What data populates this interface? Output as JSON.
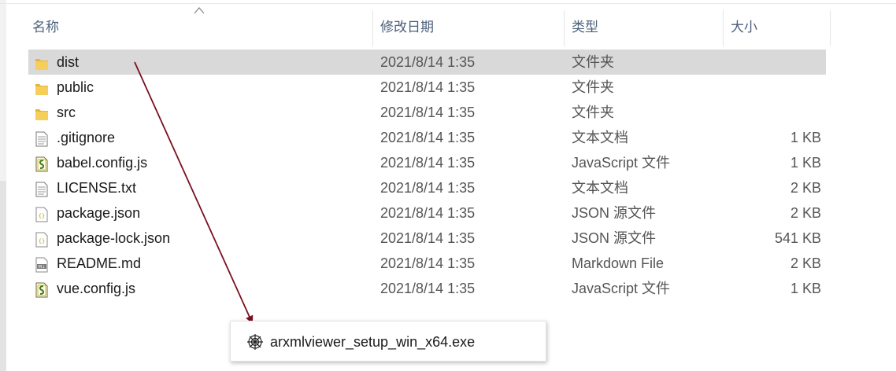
{
  "columns": {
    "name": "名称",
    "date": "修改日期",
    "type": "类型",
    "size": "大小"
  },
  "files": [
    {
      "name": "dist",
      "date": "2021/8/14 1:35",
      "type": "文件夹",
      "size": "",
      "icon": "folder-icon",
      "selected": true
    },
    {
      "name": "public",
      "date": "2021/8/14 1:35",
      "type": "文件夹",
      "size": "",
      "icon": "folder-icon"
    },
    {
      "name": "src",
      "date": "2021/8/14 1:35",
      "type": "文件夹",
      "size": "",
      "icon": "folder-icon"
    },
    {
      "name": ".gitignore",
      "date": "2021/8/14 1:35",
      "type": "文本文档",
      "size": "1 KB",
      "icon": "text-file-icon"
    },
    {
      "name": "babel.config.js",
      "date": "2021/8/14 1:35",
      "type": "JavaScript 文件",
      "size": "1 KB",
      "icon": "javascript-file-icon"
    },
    {
      "name": "LICENSE.txt",
      "date": "2021/8/14 1:35",
      "type": "文本文档",
      "size": "2 KB",
      "icon": "text-file-icon"
    },
    {
      "name": "package.json",
      "date": "2021/8/14 1:35",
      "type": "JSON 源文件",
      "size": "2 KB",
      "icon": "json-file-icon"
    },
    {
      "name": "package-lock.json",
      "date": "2021/8/14 1:35",
      "type": "JSON 源文件",
      "size": "541 KB",
      "icon": "json-file-icon"
    },
    {
      "name": "README.md",
      "date": "2021/8/14 1:35",
      "type": "Markdown File",
      "size": "2 KB",
      "icon": "markdown-file-icon"
    },
    {
      "name": "vue.config.js",
      "date": "2021/8/14 1:35",
      "type": "JavaScript 文件",
      "size": "1 KB",
      "icon": "javascript-file-icon"
    }
  ],
  "drag_tooltip": {
    "label": "arxmlviewer_setup_win_x64.exe",
    "icon": "web-installer-icon"
  },
  "colors": {
    "header_text": "#4c607a",
    "selection": "#d9d9d9",
    "arrow": "#7a1020",
    "folder": "#f0c24a"
  }
}
